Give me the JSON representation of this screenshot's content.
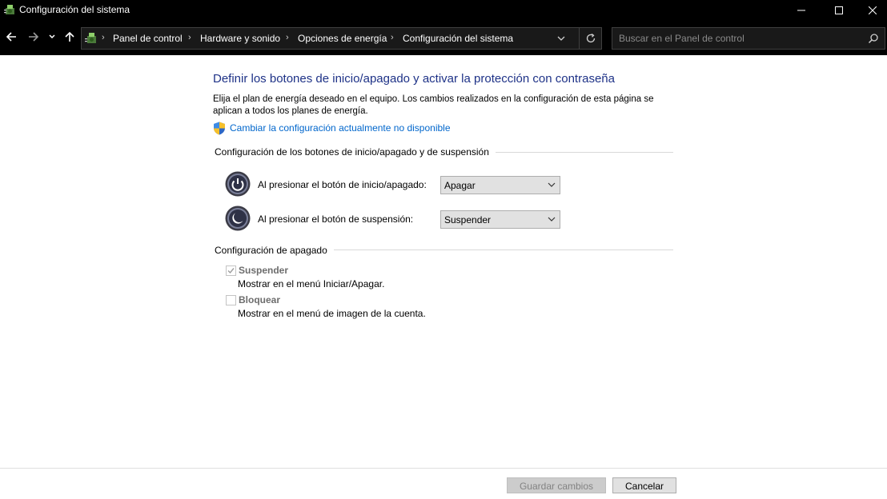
{
  "window": {
    "title": "Configuración del sistema",
    "icon": "power-options-icon",
    "controls": [
      "minimize-icon",
      "maximize-icon",
      "close-icon"
    ]
  },
  "navigation": {
    "breadcrumbs": [
      "Panel de control",
      "Hardware y sonido",
      "Opciones de energía",
      "Configuración del sistema"
    ],
    "search_placeholder": "Buscar en el Panel de control"
  },
  "content": {
    "heading": "Definir los botones de inicio/apagado y activar la protección con contraseña",
    "description": "Elija el plan de energía deseado en el equipo. Los cambios realizados en la configuración de esta página se aplican a todos los planes de energía.",
    "admin_link": "Cambiar la configuración actualmente no disponible",
    "buttons_section": {
      "title": "Configuración de los botones de inicio/apagado y de suspensión",
      "rows": [
        {
          "label": "Al presionar el botón de inicio/apagado:",
          "value": "Apagar",
          "icon": "power-button-icon"
        },
        {
          "label": "Al presionar el botón de suspensión:",
          "value": "Suspender",
          "icon": "sleep-button-icon"
        }
      ]
    },
    "shutdown_section": {
      "title": "Configuración de apagado",
      "options": [
        {
          "label": "Suspender",
          "description": "Mostrar en el menú Iniciar/Apagar.",
          "checked": true,
          "enabled": false
        },
        {
          "label": "Bloquear",
          "description": "Mostrar en el menú de imagen de la cuenta.",
          "checked": false,
          "enabled": false
        }
      ]
    }
  },
  "footer": {
    "save_label": "Guardar cambios",
    "save_enabled": false,
    "cancel_label": "Cancelar"
  },
  "colors": {
    "chrome": "#000000",
    "heading": "#1e3287",
    "link": "#0066cc",
    "disabled_text": "#6d6d6d"
  }
}
